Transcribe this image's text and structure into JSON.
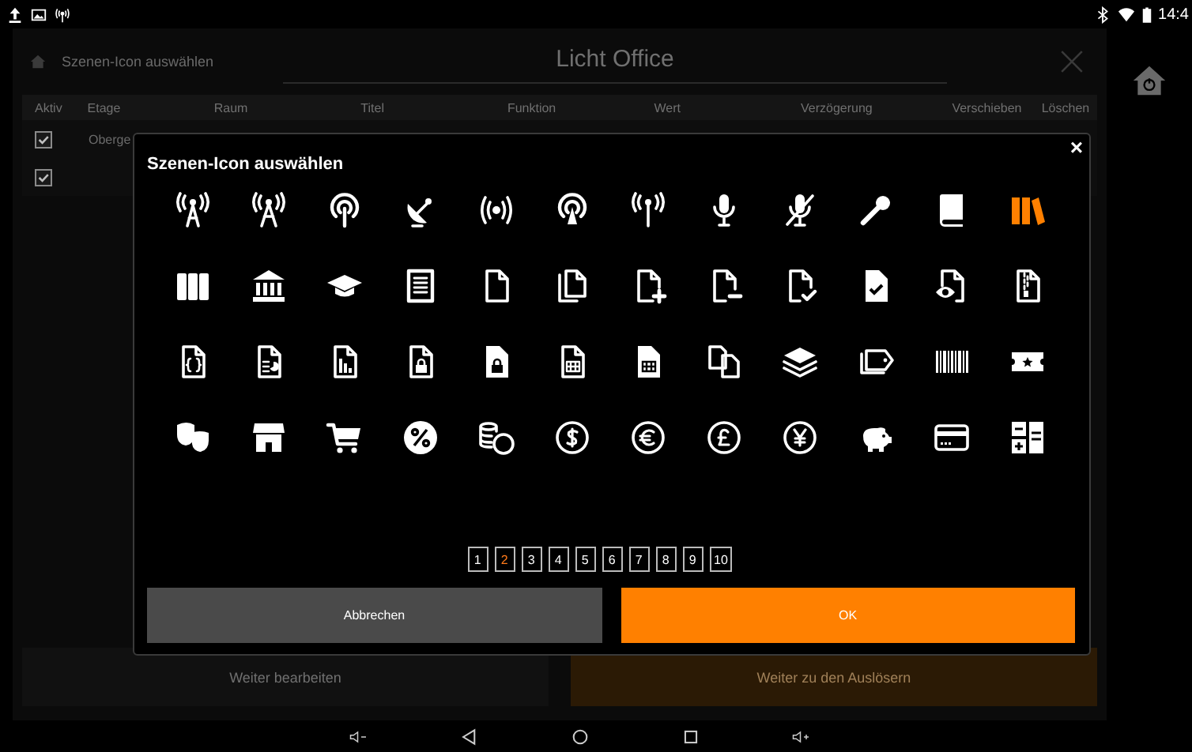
{
  "status_bar": {
    "time": "14:4"
  },
  "background": {
    "header": {
      "breadcrumb": "Szenen-Icon auswählen",
      "title": "Licht Office"
    },
    "table": {
      "columns": [
        "Aktiv",
        "Etage",
        "Raum",
        "Titel",
        "Funktion",
        "Wert",
        "Verzögerung",
        "Verschieben",
        "Löschen"
      ],
      "rows": [
        {
          "active": true,
          "etage": "Oberge"
        },
        {
          "active": true
        }
      ]
    },
    "buttons": [
      {
        "label": "Weiter bearbeiten",
        "kind": "secondary"
      },
      {
        "label": "Weiter zu den Auslösern",
        "kind": "primary"
      }
    ]
  },
  "dialog": {
    "title": "Szenen-Icon auswählen",
    "close": "×",
    "icons": [
      {
        "selected": false
      },
      {
        "selected": false
      },
      {
        "selected": false
      },
      {
        "selected": false
      },
      {
        "selected": false
      },
      {
        "selected": false
      },
      {
        "selected": false
      },
      {
        "selected": false
      },
      {
        "selected": false
      },
      {
        "selected": false
      },
      {
        "selected": false
      },
      {
        "selected": true
      },
      {
        "selected": false
      },
      {
        "selected": false
      },
      {
        "selected": false
      },
      {
        "selected": false
      },
      {
        "selected": false
      },
      {
        "selected": false
      },
      {
        "selected": false
      },
      {
        "selected": false
      },
      {
        "selected": false
      },
      {
        "selected": false
      },
      {
        "selected": false
      },
      {
        "selected": false
      },
      {
        "selected": false
      },
      {
        "selected": false
      },
      {
        "selected": false
      },
      {
        "selected": false
      },
      {
        "selected": false
      },
      {
        "selected": false
      },
      {
        "selected": false
      },
      {
        "selected": false
      },
      {
        "selected": false
      },
      {
        "selected": false
      },
      {
        "selected": false
      },
      {
        "selected": false
      },
      {
        "selected": false
      },
      {
        "selected": false
      },
      {
        "selected": false
      },
      {
        "selected": false
      },
      {
        "selected": false
      },
      {
        "selected": false
      },
      {
        "selected": false
      },
      {
        "selected": false
      },
      {
        "selected": false
      },
      {
        "selected": false
      },
      {
        "selected": false
      },
      {
        "selected": false
      }
    ],
    "pages": [
      {
        "label": "1",
        "selected": false
      },
      {
        "label": "2",
        "selected": true
      },
      {
        "label": "3",
        "selected": false
      },
      {
        "label": "4",
        "selected": false
      },
      {
        "label": "5",
        "selected": false
      },
      {
        "label": "6",
        "selected": false
      },
      {
        "label": "7",
        "selected": false
      },
      {
        "label": "8",
        "selected": false
      },
      {
        "label": "9",
        "selected": false
      },
      {
        "label": "10",
        "selected": false
      }
    ],
    "buttons": [
      {
        "label": "Abbrechen",
        "kind": "secondary"
      },
      {
        "label": "OK",
        "kind": "primary"
      }
    ]
  }
}
